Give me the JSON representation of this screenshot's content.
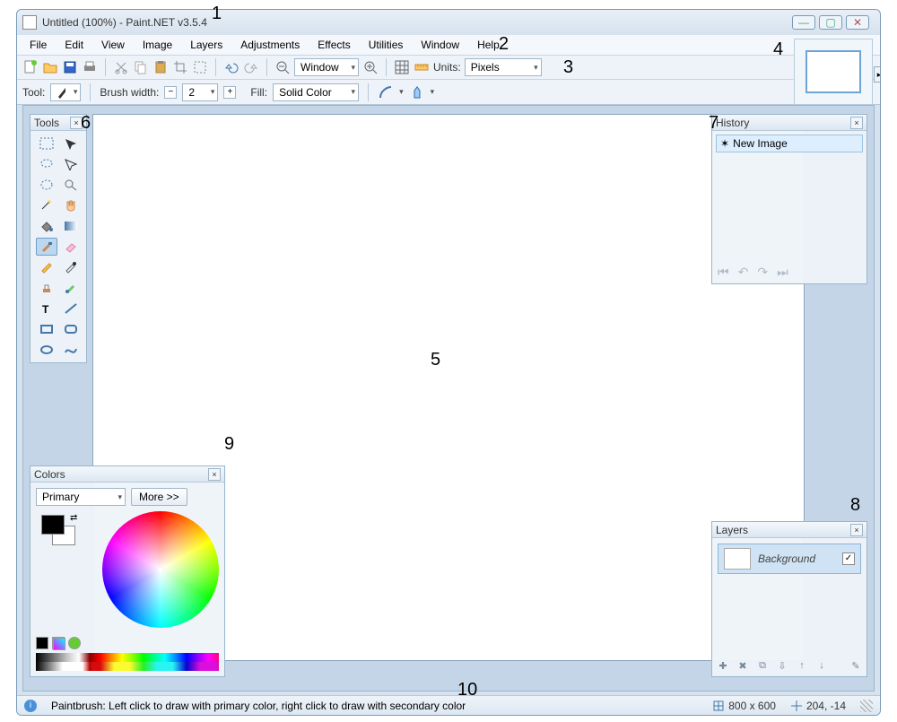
{
  "window": {
    "title": "Untitled (100%) - Paint.NET v3.5.4"
  },
  "menu": {
    "items": [
      "File",
      "Edit",
      "View",
      "Image",
      "Layers",
      "Adjustments",
      "Effects",
      "Utilities",
      "Window",
      "Help"
    ]
  },
  "toolbar1": {
    "zoom_mode": "Window",
    "units_label": "Units:",
    "units_value": "Pixels"
  },
  "toolbar2": {
    "tool_label": "Tool:",
    "brush_label": "Brush width:",
    "brush_value": "2",
    "fill_label": "Fill:",
    "fill_value": "Solid Color"
  },
  "tools_panel": {
    "title": "Tools"
  },
  "history_panel": {
    "title": "History",
    "items": [
      "New Image"
    ]
  },
  "layers_panel": {
    "title": "Layers",
    "layer_name": "Background"
  },
  "colors_panel": {
    "title": "Colors",
    "mode": "Primary",
    "more": "More >>"
  },
  "statusbar": {
    "hint": "Paintbrush: Left click to draw with primary color, right click to draw with secondary color",
    "size": "800 x 600",
    "cursor": "204, -14"
  },
  "annotations": {
    "a1": "1",
    "a2": "2",
    "a3": "3",
    "a4": "4",
    "a5": "5",
    "a6": "6",
    "a7": "7",
    "a8": "8",
    "a9": "9",
    "a10": "10"
  }
}
